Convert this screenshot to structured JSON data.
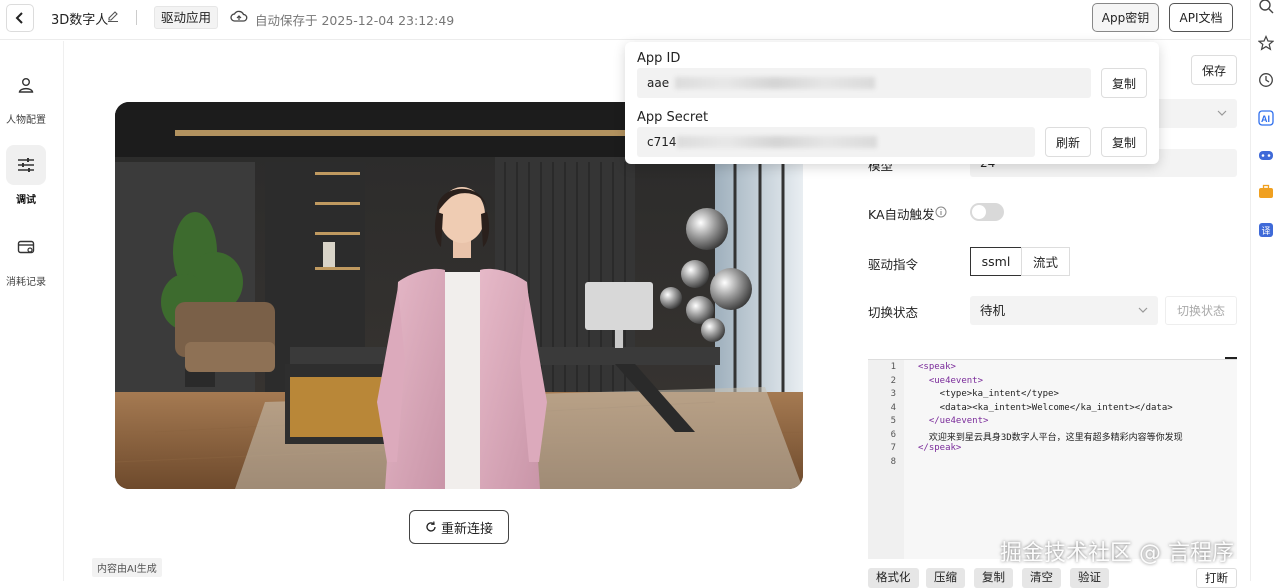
{
  "header": {
    "title": "3D数字人",
    "drive_button": "驱动应用",
    "autosave": "自动保存于 2025-12-04 23:12:49",
    "app_key_button": "App密钥",
    "api_doc_button": "API文档"
  },
  "nav": {
    "items": [
      {
        "label": "人物配置",
        "icon": "user-icon",
        "active": false
      },
      {
        "label": "调试",
        "icon": "sliders-icon",
        "active": true
      },
      {
        "label": "消耗记录",
        "icon": "card-icon",
        "active": false
      }
    ]
  },
  "scene": {
    "reconnect_button": "重新连接",
    "ai_note": "内容由AI生成"
  },
  "panel": {
    "save_button": "保存",
    "partial_label": "模型",
    "partial_value": "24",
    "ka_label": "KA自动触发",
    "drive_cmd_label": "驱动指令",
    "seg_options": [
      "ssml",
      "流式"
    ],
    "switch_state_label": "切换状态",
    "state_select": "待机",
    "switch_state_button": "切换状态"
  },
  "editor": {
    "lines": [
      "<speak>",
      "  <ue4event>",
      "    <type>ka_intent</type>",
      "    <data><ka_intent>Welcome</ka_intent></data>",
      "  </ue4event>",
      "  欢迎来到星云具身3D数字人平台，这里有超多精彩内容等你发现",
      "</speak>",
      ""
    ],
    "buttons": [
      "格式化",
      "压缩",
      "复制",
      "清空",
      "验证"
    ],
    "interrupt_button": "打断"
  },
  "popup": {
    "app_id_label": "App ID",
    "app_id_value": "aae",
    "app_secret_label": "App Secret",
    "app_secret_value": "c714",
    "copy_button": "复制",
    "refresh_button": "刷新"
  },
  "watermark": "掘金技术社区 @ 言程序",
  "colors": {
    "accent": "#222222",
    "ai_icon": "#2f6fed",
    "game_icon": "#3f6ad8",
    "briefcase_icon": "#f0a020",
    "translate_icon": "#3f6ad8"
  }
}
